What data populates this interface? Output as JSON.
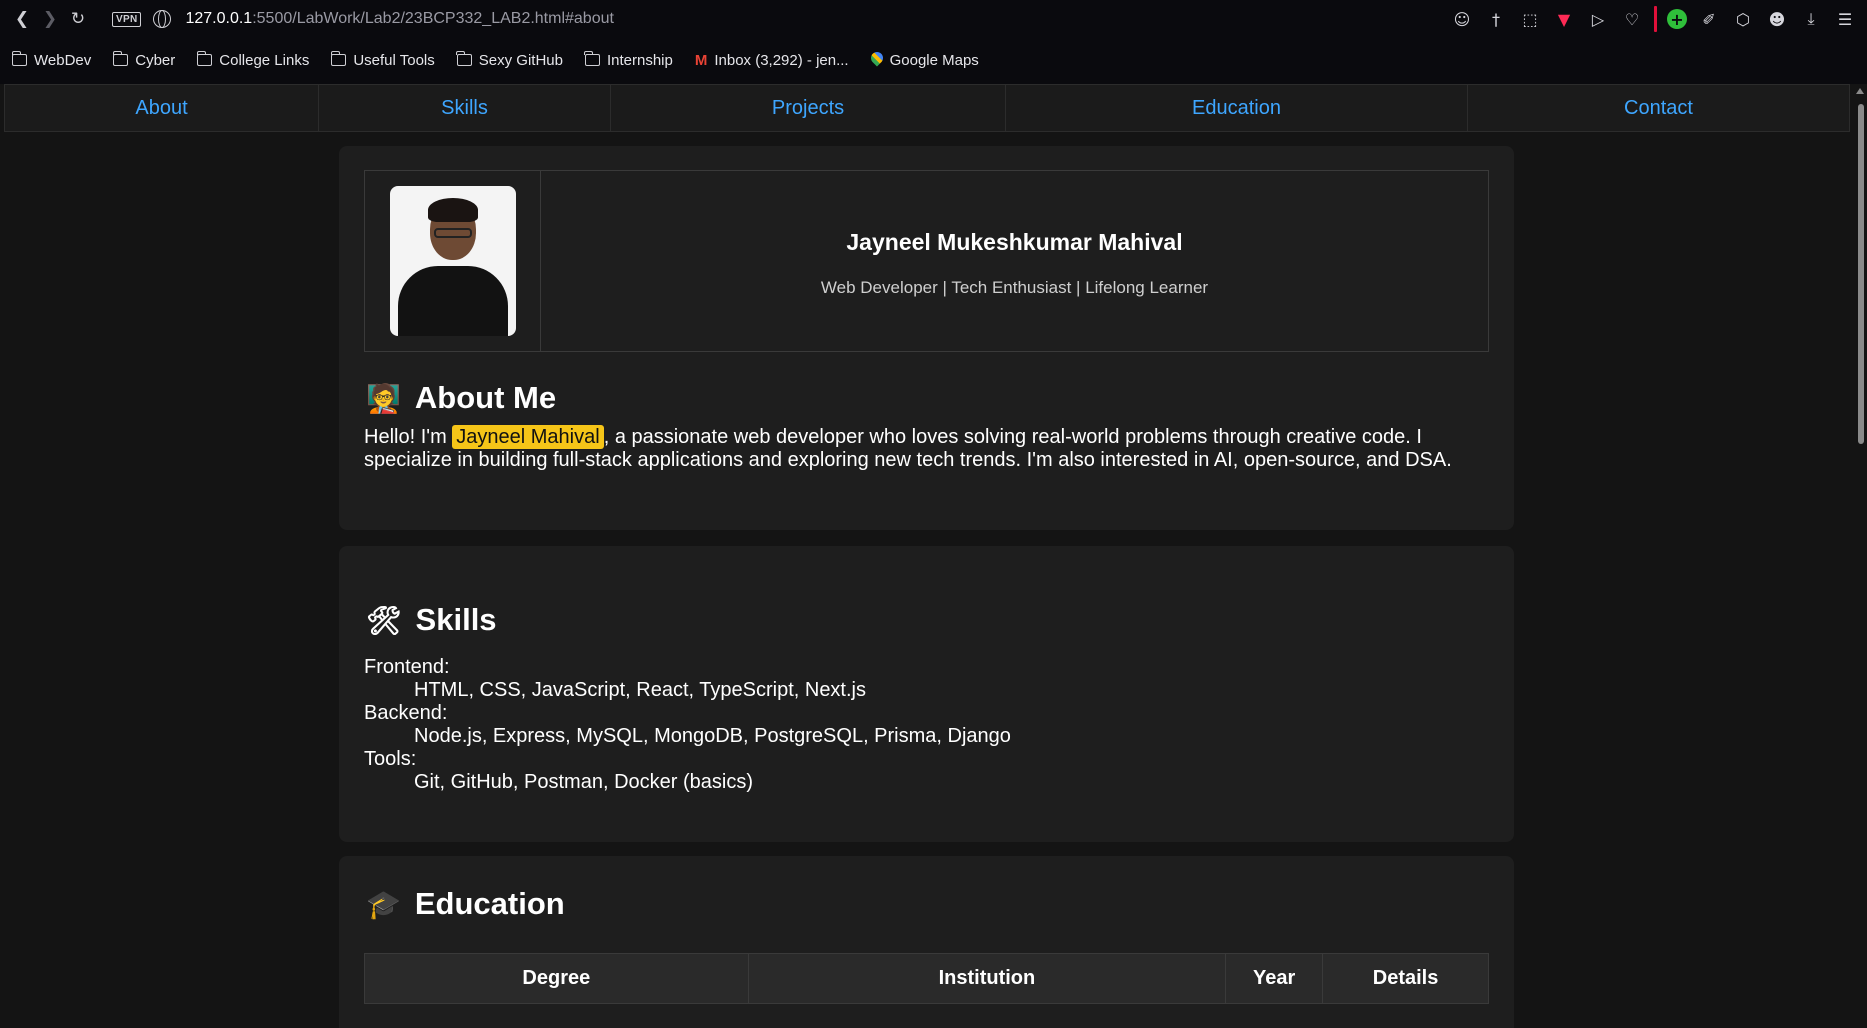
{
  "browser": {
    "url_host": "127.0.0.1",
    "url_path": ":5500/LabWork/Lab2/23BCP332_LAB2.html#about",
    "vpn_label": "VPN",
    "bookmarks": [
      {
        "label": "WebDev",
        "icon": "folder-icon"
      },
      {
        "label": "Cyber",
        "icon": "folder-icon"
      },
      {
        "label": "College Links",
        "icon": "folder-icon"
      },
      {
        "label": "Useful Tools",
        "icon": "folder-icon"
      },
      {
        "label": "Sexy GitHub",
        "icon": "folder-icon"
      },
      {
        "label": "Internship",
        "icon": "folder-icon"
      },
      {
        "label": "Inbox (3,292) - jen...",
        "icon": "gmail-icon"
      },
      {
        "label": "Google Maps",
        "icon": "maps-pin-icon"
      }
    ]
  },
  "nav": [
    "About",
    "Skills",
    "Projects",
    "Education",
    "Contact"
  ],
  "profile": {
    "name": "Jayneel Mukeshkumar Mahival",
    "tagline": "Web Developer | Tech Enthusiast | Lifelong Learner"
  },
  "about": {
    "heading": "About Me",
    "emoji": "🧑‍🏫",
    "intro": "Hello! I'm ",
    "highlight": "Jayneel Mahival",
    "rest": ", a passionate web developer who loves solving real-world problems through creative code. I specialize in building full-stack applications and exploring new tech trends. I'm also interested in AI, open-source, and DSA."
  },
  "skills": {
    "heading": "Skills",
    "emoji": "🛠",
    "groups": [
      {
        "term": "Frontend:",
        "items": "HTML, CSS, JavaScript, React, TypeScript, Next.js"
      },
      {
        "term": "Backend:",
        "items": "Node.js, Express, MySQL, MongoDB, PostgreSQL, Prisma, Django"
      },
      {
        "term": "Tools:",
        "items": "Git, GitHub, Postman, Docker (basics)"
      }
    ]
  },
  "education": {
    "heading": "Education",
    "emoji": "🎓",
    "columns": [
      "Degree",
      "Institution",
      "Year",
      "Details"
    ]
  },
  "colors": {
    "link": "#3ea6ff",
    "highlight": "#f6c518",
    "card": "#1e1e1e"
  }
}
